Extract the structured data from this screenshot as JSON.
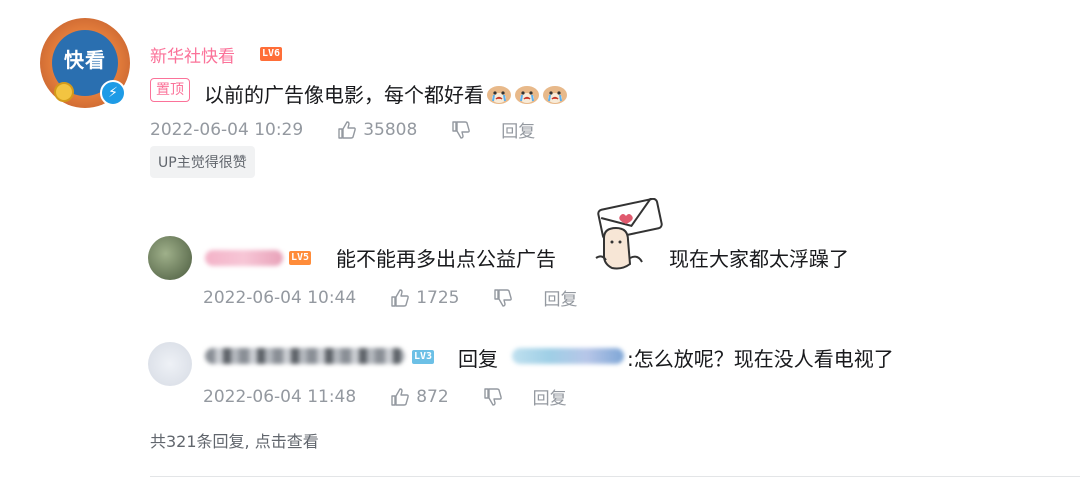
{
  "comment": {
    "username": "新华社快看",
    "level": "LV6",
    "avatar_text": "快看",
    "pin_label": "置顶",
    "content": "以前的广告像电影，每个都好看",
    "emoji": [
      "doge-cry-emoji",
      "doge-cry-emoji",
      "doge-cry-emoji"
    ],
    "time": "2022-06-04 10:29",
    "likes": "35808",
    "reply_label": "回复",
    "up_badge": "UP主觉得很赞"
  },
  "replies": [
    {
      "level": "LV5",
      "content_before": "能不能再多出点公益广告",
      "content_after": "现在大家都太浮躁了",
      "time": "2022-06-04 10:44",
      "likes": "1725",
      "reply_label": "回复"
    },
    {
      "level": "LV3",
      "reply_prefix": "回复",
      "content": ":怎么放呢？现在没人看电视了",
      "time": "2022-06-04 11:48",
      "likes": "872",
      "reply_label": "回复"
    }
  ],
  "footer": {
    "more_replies": "共321条回复, 点击查看"
  },
  "colors": {
    "username_pink": "#fb7299",
    "meta_gray": "#9499a0",
    "level6": "#ff6e38",
    "level3": "#6cc0e6"
  }
}
